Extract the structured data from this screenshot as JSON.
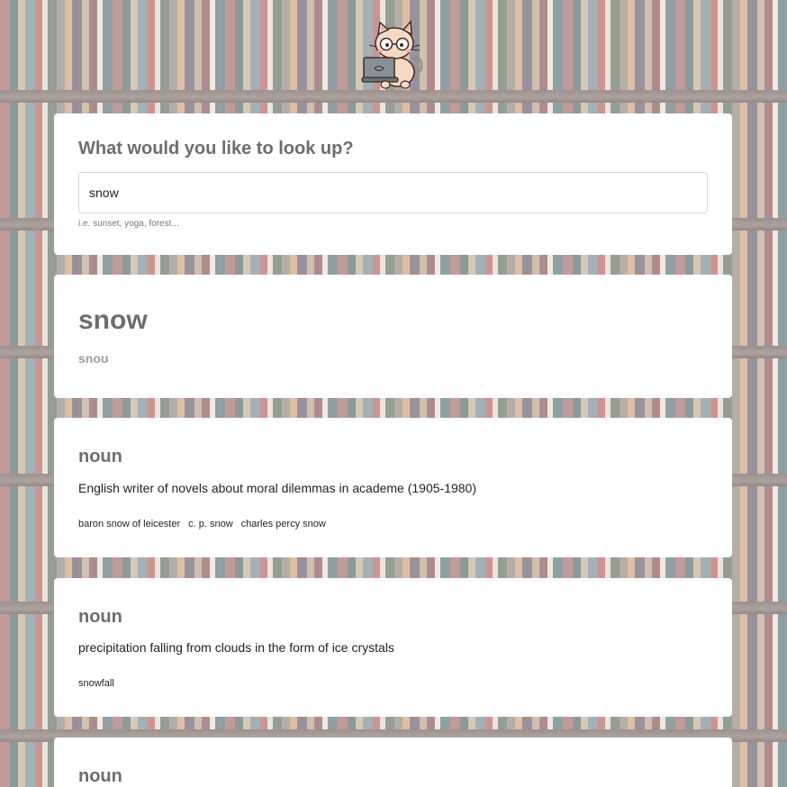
{
  "search": {
    "heading": "What would you like to look up?",
    "value": "snow",
    "hint": "i.e. sunset, yoga, forest..."
  },
  "word": {
    "title": "snow",
    "phonetic": "snoʊ"
  },
  "meanings": [
    {
      "part_of_speech": "noun",
      "definition": "English writer of novels about moral dilemmas in academe (1905-1980)",
      "synonyms": [
        "baron snow of leicester",
        "c. p. snow",
        "charles percy snow"
      ]
    },
    {
      "part_of_speech": "noun",
      "definition": "precipitation falling from clouds in the form of ice crystals",
      "synonyms": [
        "snowfall"
      ]
    },
    {
      "part_of_speech": "noun"
    }
  ],
  "icons": {
    "mascot": "cat-with-laptop-icon"
  }
}
